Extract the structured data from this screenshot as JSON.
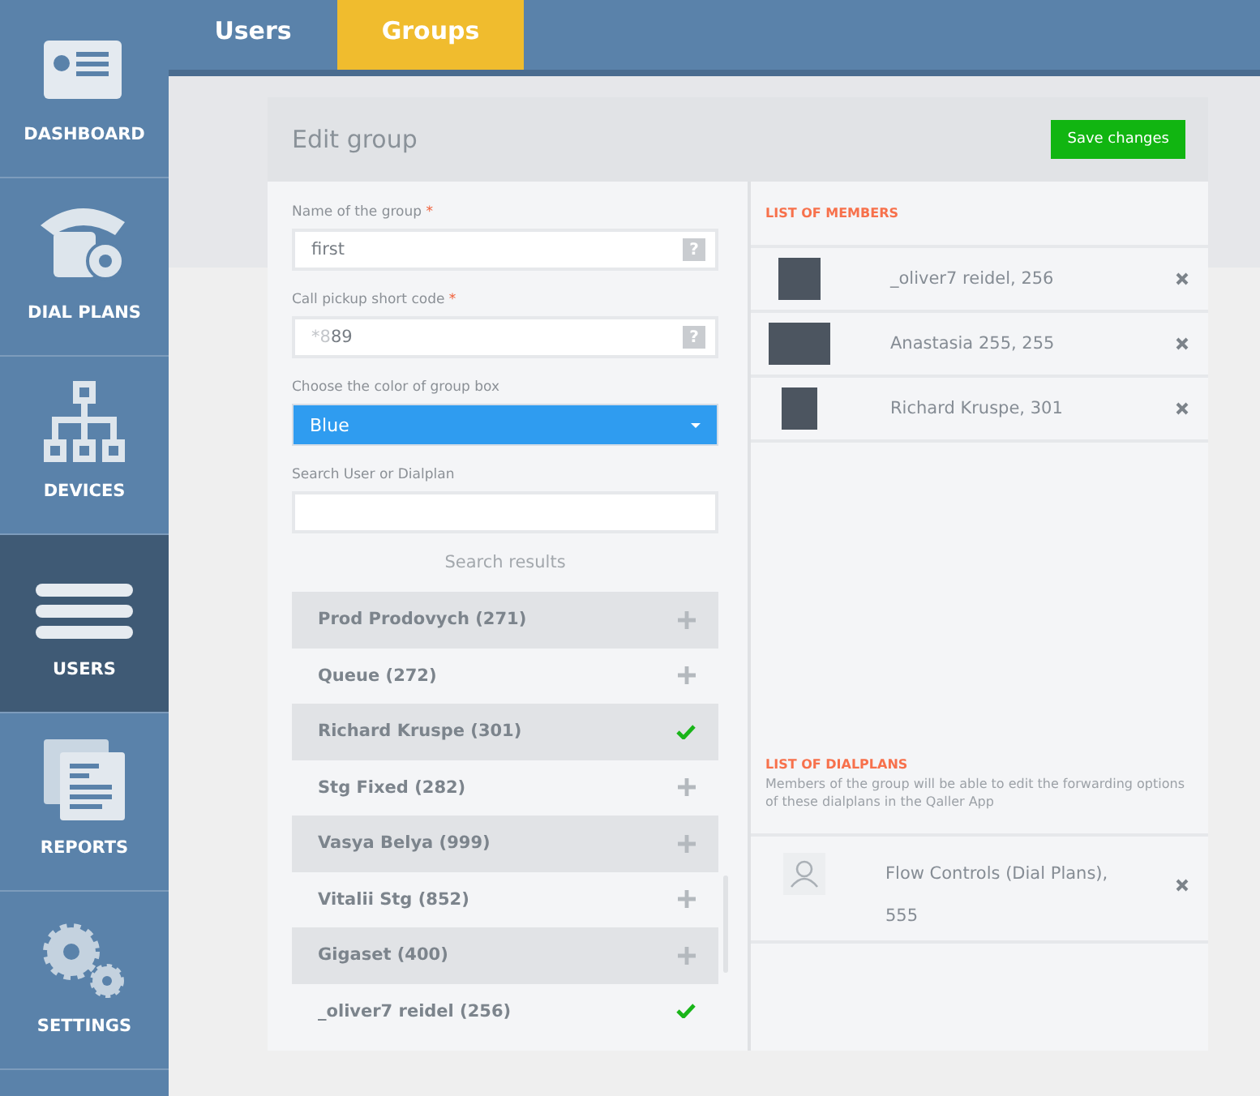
{
  "sidebar": {
    "items": [
      {
        "label": "DASHBOARD",
        "selected": false
      },
      {
        "label": "DIAL PLANS",
        "selected": false
      },
      {
        "label": "DEVICES",
        "selected": false
      },
      {
        "label": "USERS",
        "selected": true
      },
      {
        "label": "REPORTS",
        "selected": false
      },
      {
        "label": "SETTINGS",
        "selected": false
      }
    ]
  },
  "tabs": [
    {
      "label": "Users",
      "selected": false
    },
    {
      "label": "Groups",
      "selected": true
    }
  ],
  "panel": {
    "title": "Edit group",
    "save_button": "Save changes",
    "fields": [
      {
        "label": "Name of the group",
        "required_mark": "*",
        "value": "first",
        "help": "?"
      },
      {
        "label": "Call pickup short code",
        "required_mark": "*",
        "value": "89",
        "hint_prefix": "*8",
        "help": "?"
      }
    ],
    "color_select": {
      "label": "Choose the color of group box",
      "value": "Blue"
    },
    "search": {
      "label": "Search User or Dialplan"
    },
    "results_title": "Search results",
    "results": [
      {
        "name": "Prod Prodovych (271)",
        "added": false
      },
      {
        "name": "Queue (272)",
        "added": false
      },
      {
        "name": "Richard Kruspe (301)",
        "added": true
      },
      {
        "name": "Stg Fixed (282)",
        "added": false
      },
      {
        "name": "Vasya Belya (999)",
        "added": false
      },
      {
        "name": "Vitalii Stg (852)",
        "added": false
      },
      {
        "name": "Gigaset (400)",
        "added": false
      },
      {
        "name": "_oliver7 reidel (256)",
        "added": true
      }
    ],
    "members_title": "LIST OF MEMBERS",
    "members": [
      {
        "name": "_oliver7 reidel, 256"
      },
      {
        "name": "Anastasia 255, 255"
      },
      {
        "name": "Richard Kruspe, 301"
      }
    ],
    "dialplans_title": "LIST OF DIALPLANS",
    "dialplans_note": "Members of the group will be able to edit the forwarding options of these dialplans in the Qaller App",
    "dialplans": [
      {
        "name": "Flow Controls (Dial Plans),",
        "number": "555"
      }
    ]
  }
}
